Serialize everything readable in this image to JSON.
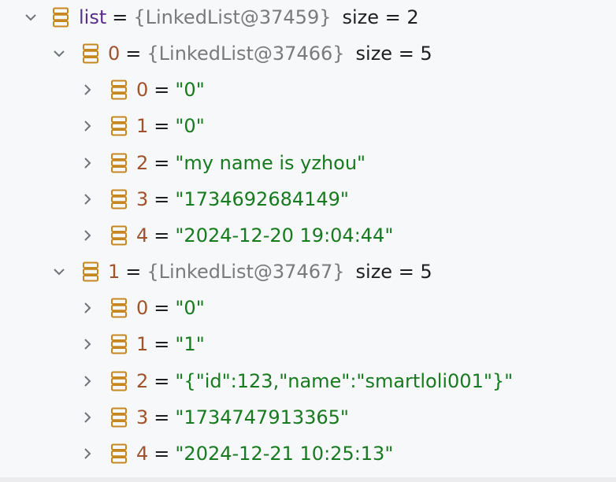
{
  "root": {
    "name": "list",
    "operator": "=",
    "ref": "{LinkedList@37459}",
    "size": "size = 2",
    "expanded": true,
    "icon": "field-stack-icon"
  },
  "groups": [
    {
      "name": "0",
      "operator": "=",
      "ref": "{LinkedList@37466}",
      "size": "size = 5",
      "expanded": true,
      "items": [
        {
          "name": "0",
          "operator": "=",
          "value": "\"0\""
        },
        {
          "name": "1",
          "operator": "=",
          "value": "\"0\""
        },
        {
          "name": "2",
          "operator": "=",
          "value": "\"my name is yzhou\""
        },
        {
          "name": "3",
          "operator": "=",
          "value": "\"1734692684149\""
        },
        {
          "name": "4",
          "operator": "=",
          "value": "\"2024-12-20 19:04:44\""
        }
      ]
    },
    {
      "name": "1",
      "operator": "=",
      "ref": "{LinkedList@37467}",
      "size": "size = 5",
      "expanded": true,
      "items": [
        {
          "name": "0",
          "operator": "=",
          "value": "\"0\""
        },
        {
          "name": "1",
          "operator": "=",
          "value": "\"1\""
        },
        {
          "name": "2",
          "operator": "=",
          "value": "\"{\"id\":123,\"name\":\"smartloli001\"}\""
        },
        {
          "name": "3",
          "operator": "=",
          "value": "\"1734747913365\""
        },
        {
          "name": "4",
          "operator": "=",
          "value": "\"2024-12-21 10:25:13\""
        }
      ]
    }
  ],
  "colors": {
    "icon": "#c7871f",
    "arrow": "#6f737a",
    "string": "#177a1e",
    "ref": "#7a7a7a",
    "background": "#f7f8fa"
  }
}
